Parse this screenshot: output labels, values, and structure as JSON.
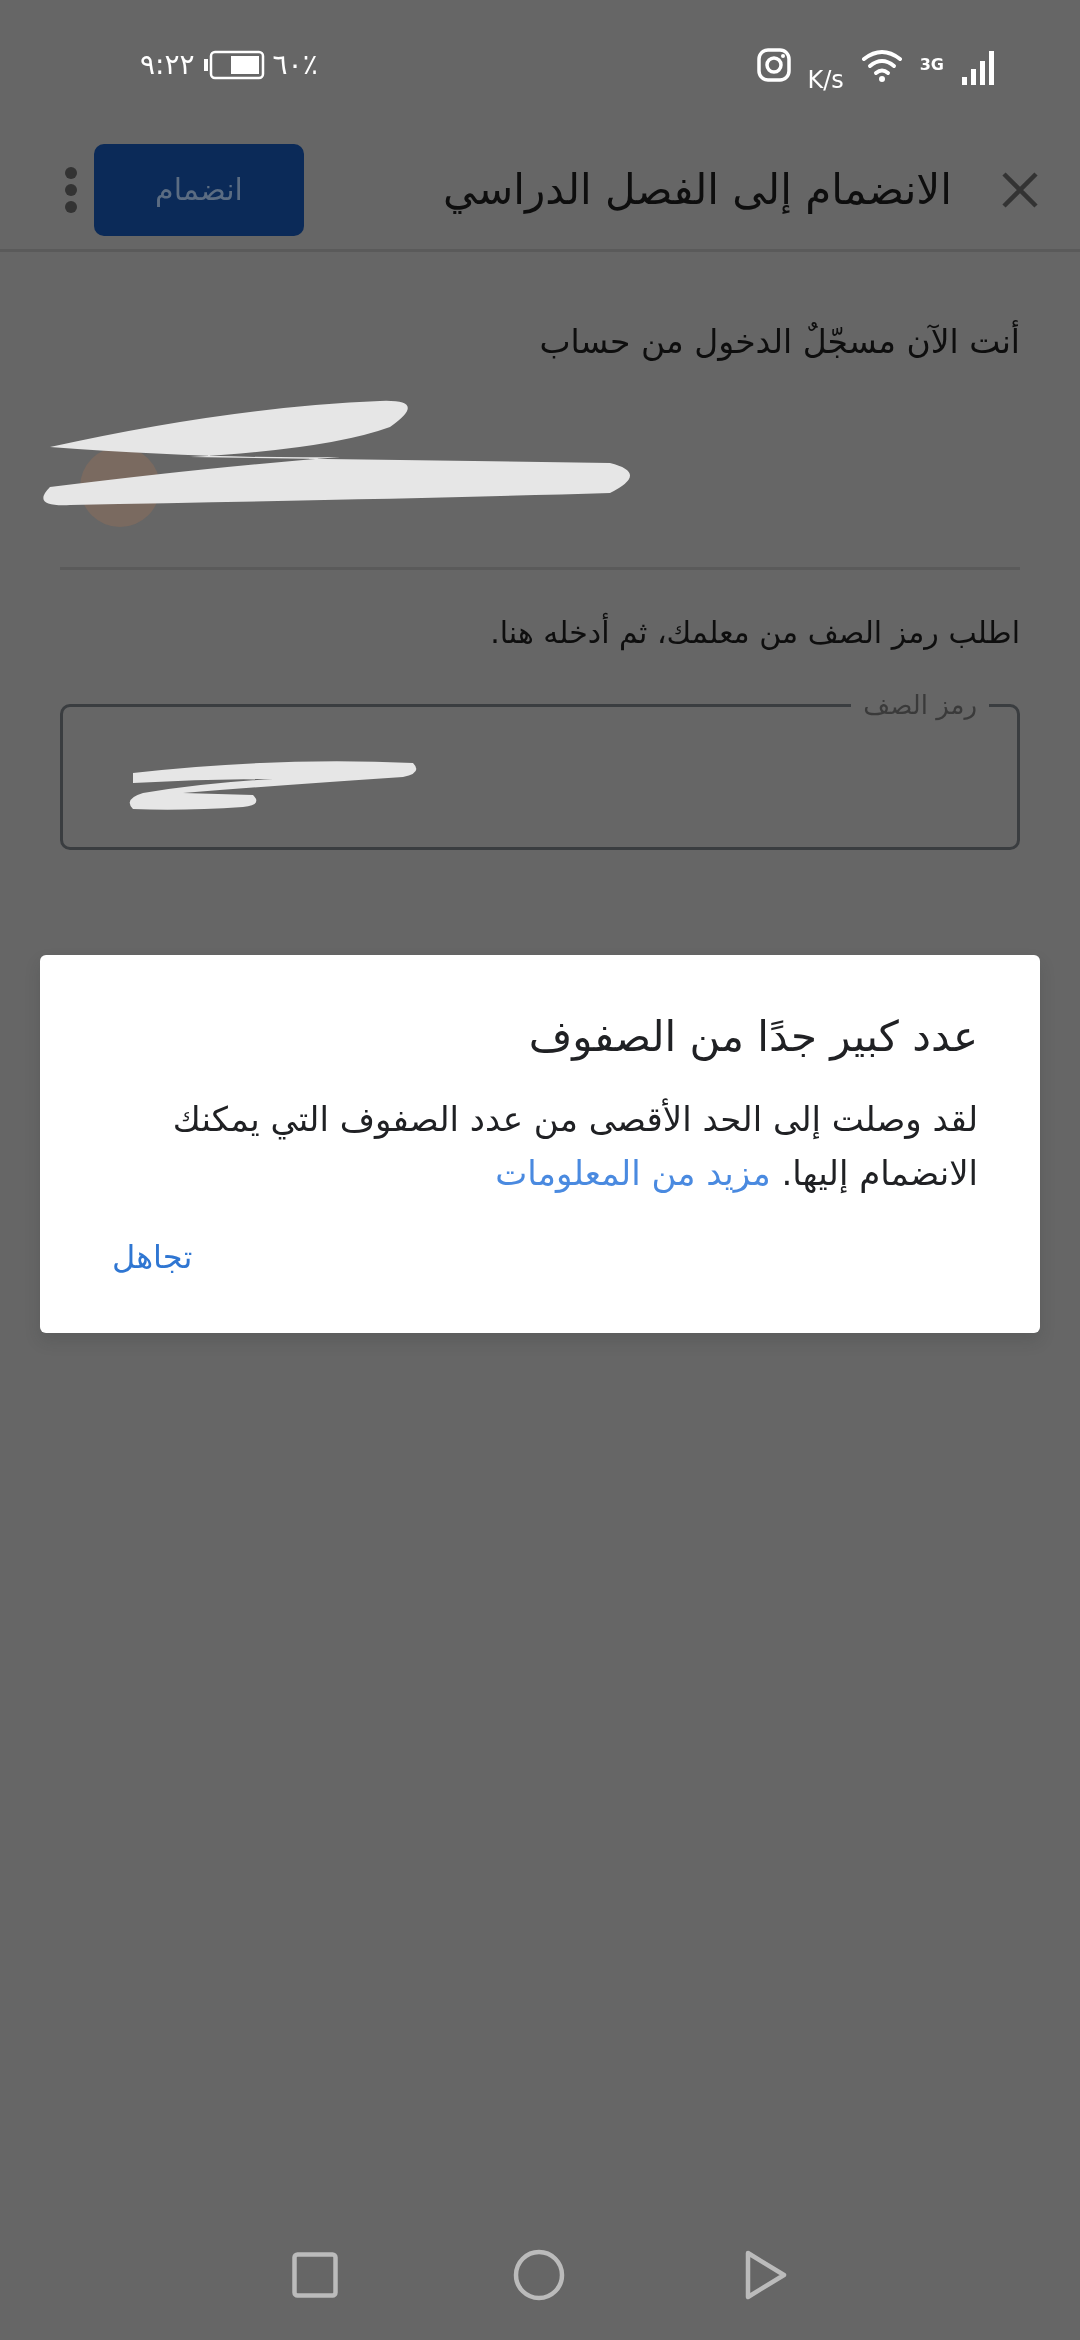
{
  "status_bar": {
    "time": "٩:٢٢",
    "battery": "٪٦٠",
    "speed": "K/s",
    "network": "3G"
  },
  "app_bar": {
    "title": "الانضمام إلى الفصل الدراسي",
    "join_button": {
      "label": "انضمام",
      "disabled": true
    }
  },
  "account": {
    "label": "أنت الآن مسجّلٌ الدخول من حساب"
  },
  "instruction": "اطلب رمز الصف من معلمك، ثم أدخله هنا.",
  "class_code_field": {
    "label": "رمز الصف"
  },
  "dialog": {
    "title": "عدد كبير جدًا من الصفوف",
    "body": "لقد وصلت إلى الحد الأقصى من عدد الصفوف التي يمكنك الانضمام إليها.",
    "link": "مزيد من المعلومات",
    "dismiss": "تجاهل"
  }
}
